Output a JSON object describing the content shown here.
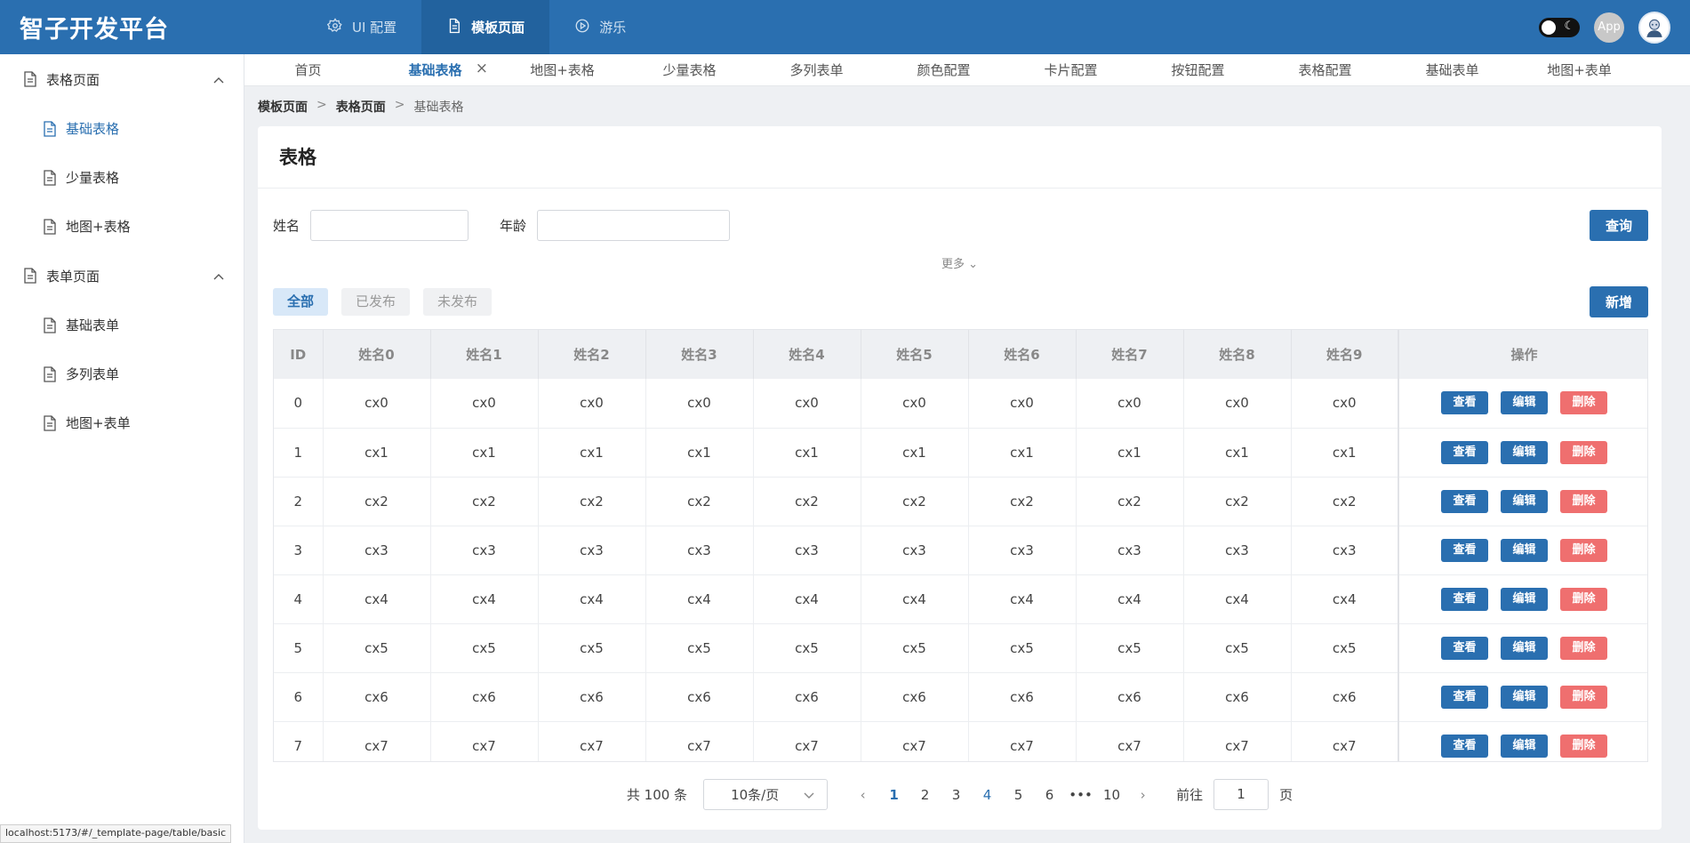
{
  "header": {
    "brand": "智子开发平台",
    "nav": [
      {
        "label": "UI 配置",
        "icon": "gear-icon"
      },
      {
        "label": "模板页面",
        "icon": "document-icon"
      },
      {
        "label": "游乐",
        "icon": "play-circle-icon"
      }
    ],
    "app_badge": "App",
    "theme_moon": "☾"
  },
  "sidebar": {
    "groups": [
      {
        "label": "表格页面",
        "items": [
          {
            "label": "基础表格"
          },
          {
            "label": "少量表格"
          },
          {
            "label": "地图+表格"
          }
        ]
      },
      {
        "label": "表单页面",
        "items": [
          {
            "label": "基础表单"
          },
          {
            "label": "多列表单"
          },
          {
            "label": "地图+表单"
          }
        ]
      }
    ]
  },
  "tabs": [
    "首页",
    "基础表格",
    "地图+表格",
    "少量表格",
    "多列表单",
    "颜色配置",
    "卡片配置",
    "按钮配置",
    "表格配置",
    "基础表单",
    "地图+表单"
  ],
  "tab_close": "×",
  "breadcrumb": [
    "模板页面",
    "表格页面",
    "基础表格"
  ],
  "breadcrumb_sep": ">",
  "card": {
    "title": "表格",
    "filters": {
      "name_label": "姓名",
      "age_label": "年龄",
      "name_value": "",
      "age_value": ""
    },
    "query_button": "查询",
    "more": "更多 ⌄",
    "status_chips": [
      "全部",
      "已发布",
      "未发布"
    ],
    "add_button": "新增"
  },
  "table": {
    "headers": [
      "ID",
      "姓名0",
      "姓名1",
      "姓名2",
      "姓名3",
      "姓名4",
      "姓名5",
      "姓名6",
      "姓名7",
      "姓名8",
      "姓名9",
      "操作"
    ],
    "rows": [
      [
        "0",
        "cx0",
        "cx0",
        "cx0",
        "cx0",
        "cx0",
        "cx0",
        "cx0",
        "cx0",
        "cx0",
        "cx0"
      ],
      [
        "1",
        "cx1",
        "cx1",
        "cx1",
        "cx1",
        "cx1",
        "cx1",
        "cx1",
        "cx1",
        "cx1",
        "cx1"
      ],
      [
        "2",
        "cx2",
        "cx2",
        "cx2",
        "cx2",
        "cx2",
        "cx2",
        "cx2",
        "cx2",
        "cx2",
        "cx2"
      ],
      [
        "3",
        "cx3",
        "cx3",
        "cx3",
        "cx3",
        "cx3",
        "cx3",
        "cx3",
        "cx3",
        "cx3",
        "cx3"
      ],
      [
        "4",
        "cx4",
        "cx4",
        "cx4",
        "cx4",
        "cx4",
        "cx4",
        "cx4",
        "cx4",
        "cx4",
        "cx4"
      ],
      [
        "5",
        "cx5",
        "cx5",
        "cx5",
        "cx5",
        "cx5",
        "cx5",
        "cx5",
        "cx5",
        "cx5",
        "cx5"
      ],
      [
        "6",
        "cx6",
        "cx6",
        "cx6",
        "cx6",
        "cx6",
        "cx6",
        "cx6",
        "cx6",
        "cx6",
        "cx6"
      ],
      [
        "7",
        "cx7",
        "cx7",
        "cx7",
        "cx7",
        "cx7",
        "cx7",
        "cx7",
        "cx7",
        "cx7",
        "cx7"
      ]
    ],
    "actions": {
      "view": "查看",
      "edit": "编辑",
      "delete": "删除"
    }
  },
  "pagination": {
    "total": "共 100 条",
    "page_size": "10条/页",
    "pages": [
      "1",
      "2",
      "3",
      "4",
      "5",
      "6",
      "•••",
      "10"
    ],
    "current": "1",
    "prev": "‹",
    "next": "›",
    "goto_label": "前往",
    "goto_value": "1",
    "goto_suffix": "页"
  },
  "status_url": "localhost:5173/#/_template-page/table/basic",
  "colors": {
    "primary": "#2a6fb0",
    "danger": "#ef6f6f",
    "header_bg": "#2a6fb0"
  }
}
